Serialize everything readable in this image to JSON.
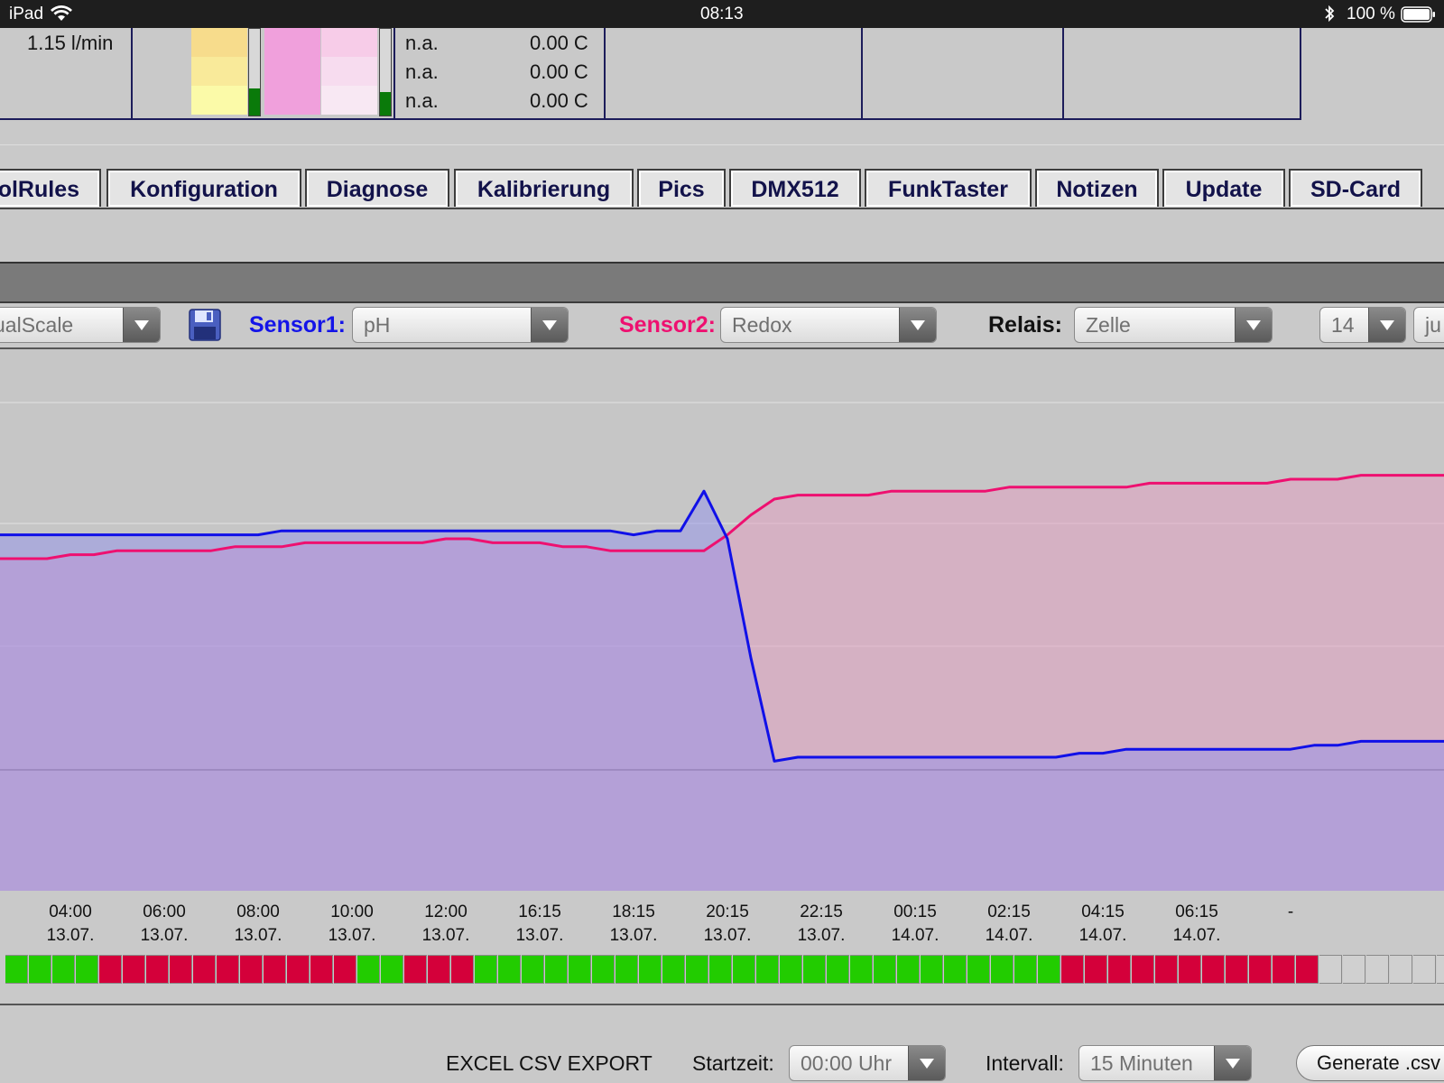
{
  "status_bar": {
    "device": "iPad",
    "time": "08:13",
    "battery": "100 %"
  },
  "top_table": {
    "flow": "1.15 l/min",
    "rows": [
      {
        "label": "n.a.",
        "value": "0.00 C"
      },
      {
        "label": "n.a.",
        "value": "0.00 C"
      },
      {
        "label": "n.a.",
        "value": "0.00 C"
      }
    ]
  },
  "tabs": [
    "olRules",
    "Konfiguration",
    "Diagnose",
    "Kalibrierung",
    "Pics",
    "DMX512",
    "FunkTaster",
    "Notizen",
    "Update",
    "SD-Card"
  ],
  "controls": {
    "scale_value": "ualScale",
    "sensor1_label": "Sensor1:",
    "sensor1_value": "pH",
    "sensor2_label": "Sensor2:",
    "sensor2_value": "Redox",
    "relais_label": "Relais:",
    "relais_value": "Zelle",
    "day_value": "14",
    "month_value": "ju"
  },
  "colors": {
    "sensor1": "#1010e8",
    "sensor2": "#ee1070",
    "relay_on": "#22cc00",
    "relay_off": "#d4003a",
    "relay_none": "#d0d0d0"
  },
  "chart_data": {
    "type": "line",
    "x": [
      "04:00 13.07.",
      "06:00 13.07.",
      "08:00 13.07.",
      "10:00 13.07.",
      "12:00 13.07.",
      "16:15 13.07.",
      "18:15 13.07.",
      "20:15 13.07.",
      "22:15 13.07.",
      "00:15 14.07.",
      "02:15 14.07.",
      "04:15 14.07.",
      "06:15 14.07.",
      "-"
    ],
    "y_min": 0,
    "y_max": 100,
    "series": [
      {
        "values": [
          76,
          76,
          76,
          76,
          76,
          76,
          76,
          76,
          76,
          76,
          76,
          76,
          77,
          77,
          77,
          77,
          77,
          77,
          77,
          77,
          77,
          77,
          77,
          77,
          77,
          77,
          77,
          76,
          77,
          77,
          87,
          75,
          45,
          19,
          20,
          20,
          20,
          20,
          20,
          20,
          20,
          20,
          20,
          20,
          20,
          20,
          21,
          21,
          22,
          22,
          22,
          22,
          22,
          22,
          22,
          22,
          23,
          23,
          24,
          24,
          24,
          24,
          24,
          24,
          24,
          24,
          24,
          24,
          25,
          25,
          26,
          26,
          26,
          26,
          26,
          26,
          26,
          26,
          27,
          27,
          27,
          27,
          27,
          27,
          27,
          27,
          28,
          28,
          28
        ]
      },
      {
        "values": [
          70,
          70,
          70,
          71,
          71,
          72,
          72,
          72,
          72,
          72,
          73,
          73,
          73,
          74,
          74,
          74,
          74,
          74,
          74,
          75,
          75,
          74,
          74,
          74,
          73,
          73,
          72,
          72,
          72,
          72,
          72,
          76,
          81,
          85,
          86,
          86,
          86,
          86,
          87,
          87,
          87,
          87,
          87,
          88,
          88,
          88,
          88,
          88,
          88,
          89,
          89,
          89,
          89,
          89,
          89,
          90,
          90,
          90,
          91,
          91,
          91,
          91,
          91,
          91,
          92,
          92,
          93,
          93,
          93,
          94,
          95,
          95,
          95,
          95,
          96,
          96,
          97,
          97,
          98,
          98,
          98,
          99,
          99,
          100,
          100,
          100,
          100,
          100,
          100
        ]
      }
    ],
    "relay_strip": [
      "on",
      "on",
      "on",
      "on",
      "off",
      "off",
      "off",
      "off",
      "off",
      "off",
      "off",
      "off",
      "off",
      "off",
      "off",
      "on",
      "on",
      "off",
      "off",
      "off",
      "on",
      "on",
      "on",
      "on",
      "on",
      "on",
      "on",
      "on",
      "on",
      "on",
      "on",
      "on",
      "on",
      "on",
      "on",
      "on",
      "on",
      "on",
      "on",
      "on",
      "on",
      "on",
      "on",
      "on",
      "on",
      "off",
      "off",
      "off",
      "off",
      "off",
      "off",
      "off",
      "off",
      "off",
      "off",
      "off",
      "none",
      "none",
      "none",
      "none",
      "none",
      "none",
      "none",
      "none"
    ]
  },
  "export": {
    "title": "EXCEL CSV EXPORT",
    "start_label": "Startzeit:",
    "start_value": "00:00 Uhr",
    "interval_label": "Intervall:",
    "interval_value": "15 Minuten",
    "generate_label": "Generate .csv"
  }
}
